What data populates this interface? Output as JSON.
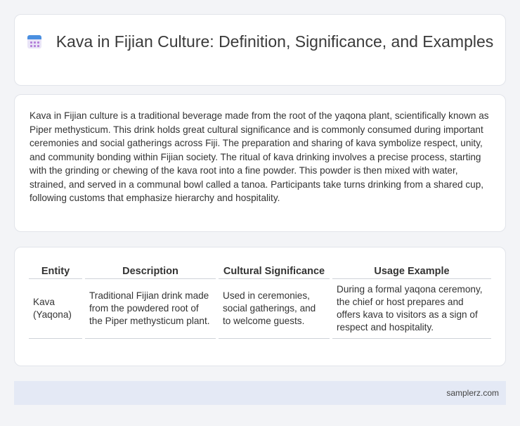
{
  "header": {
    "icon": "calendar-icon",
    "title": "Kava in Fijian Culture: Definition, Significance, and Examples"
  },
  "description": "Kava in Fijian culture is a traditional beverage made from the root of the yaqona plant, scientifically known as Piper methysticum. This drink holds great cultural significance and is commonly consumed during important ceremonies and social gatherings across Fiji. The preparation and sharing of kava symbolize respect, unity, and community bonding within Fijian society. The ritual of kava drinking involves a precise process, starting with the grinding or chewing of the kava root into a fine powder. This powder is then mixed with water, strained, and served in a communal bowl called a tanoa. Participants take turns drinking from a shared cup, following customs that emphasize hierarchy and hospitality.",
  "table": {
    "headers": [
      "Entity",
      "Description",
      "Cultural Significance",
      "Usage Example"
    ],
    "rows": [
      {
        "entity": "Kava (Yaqona)",
        "description": "Traditional Fijian drink made from the powdered root of the Piper methysticum plant.",
        "significance": "Used in ceremonies, social gatherings, and to welcome guests.",
        "example": "During a formal yaqona ceremony, the chief or host prepares and offers kava to visitors as a sign of respect and hospitality."
      }
    ]
  },
  "footer": {
    "source": "samplerz.com"
  }
}
